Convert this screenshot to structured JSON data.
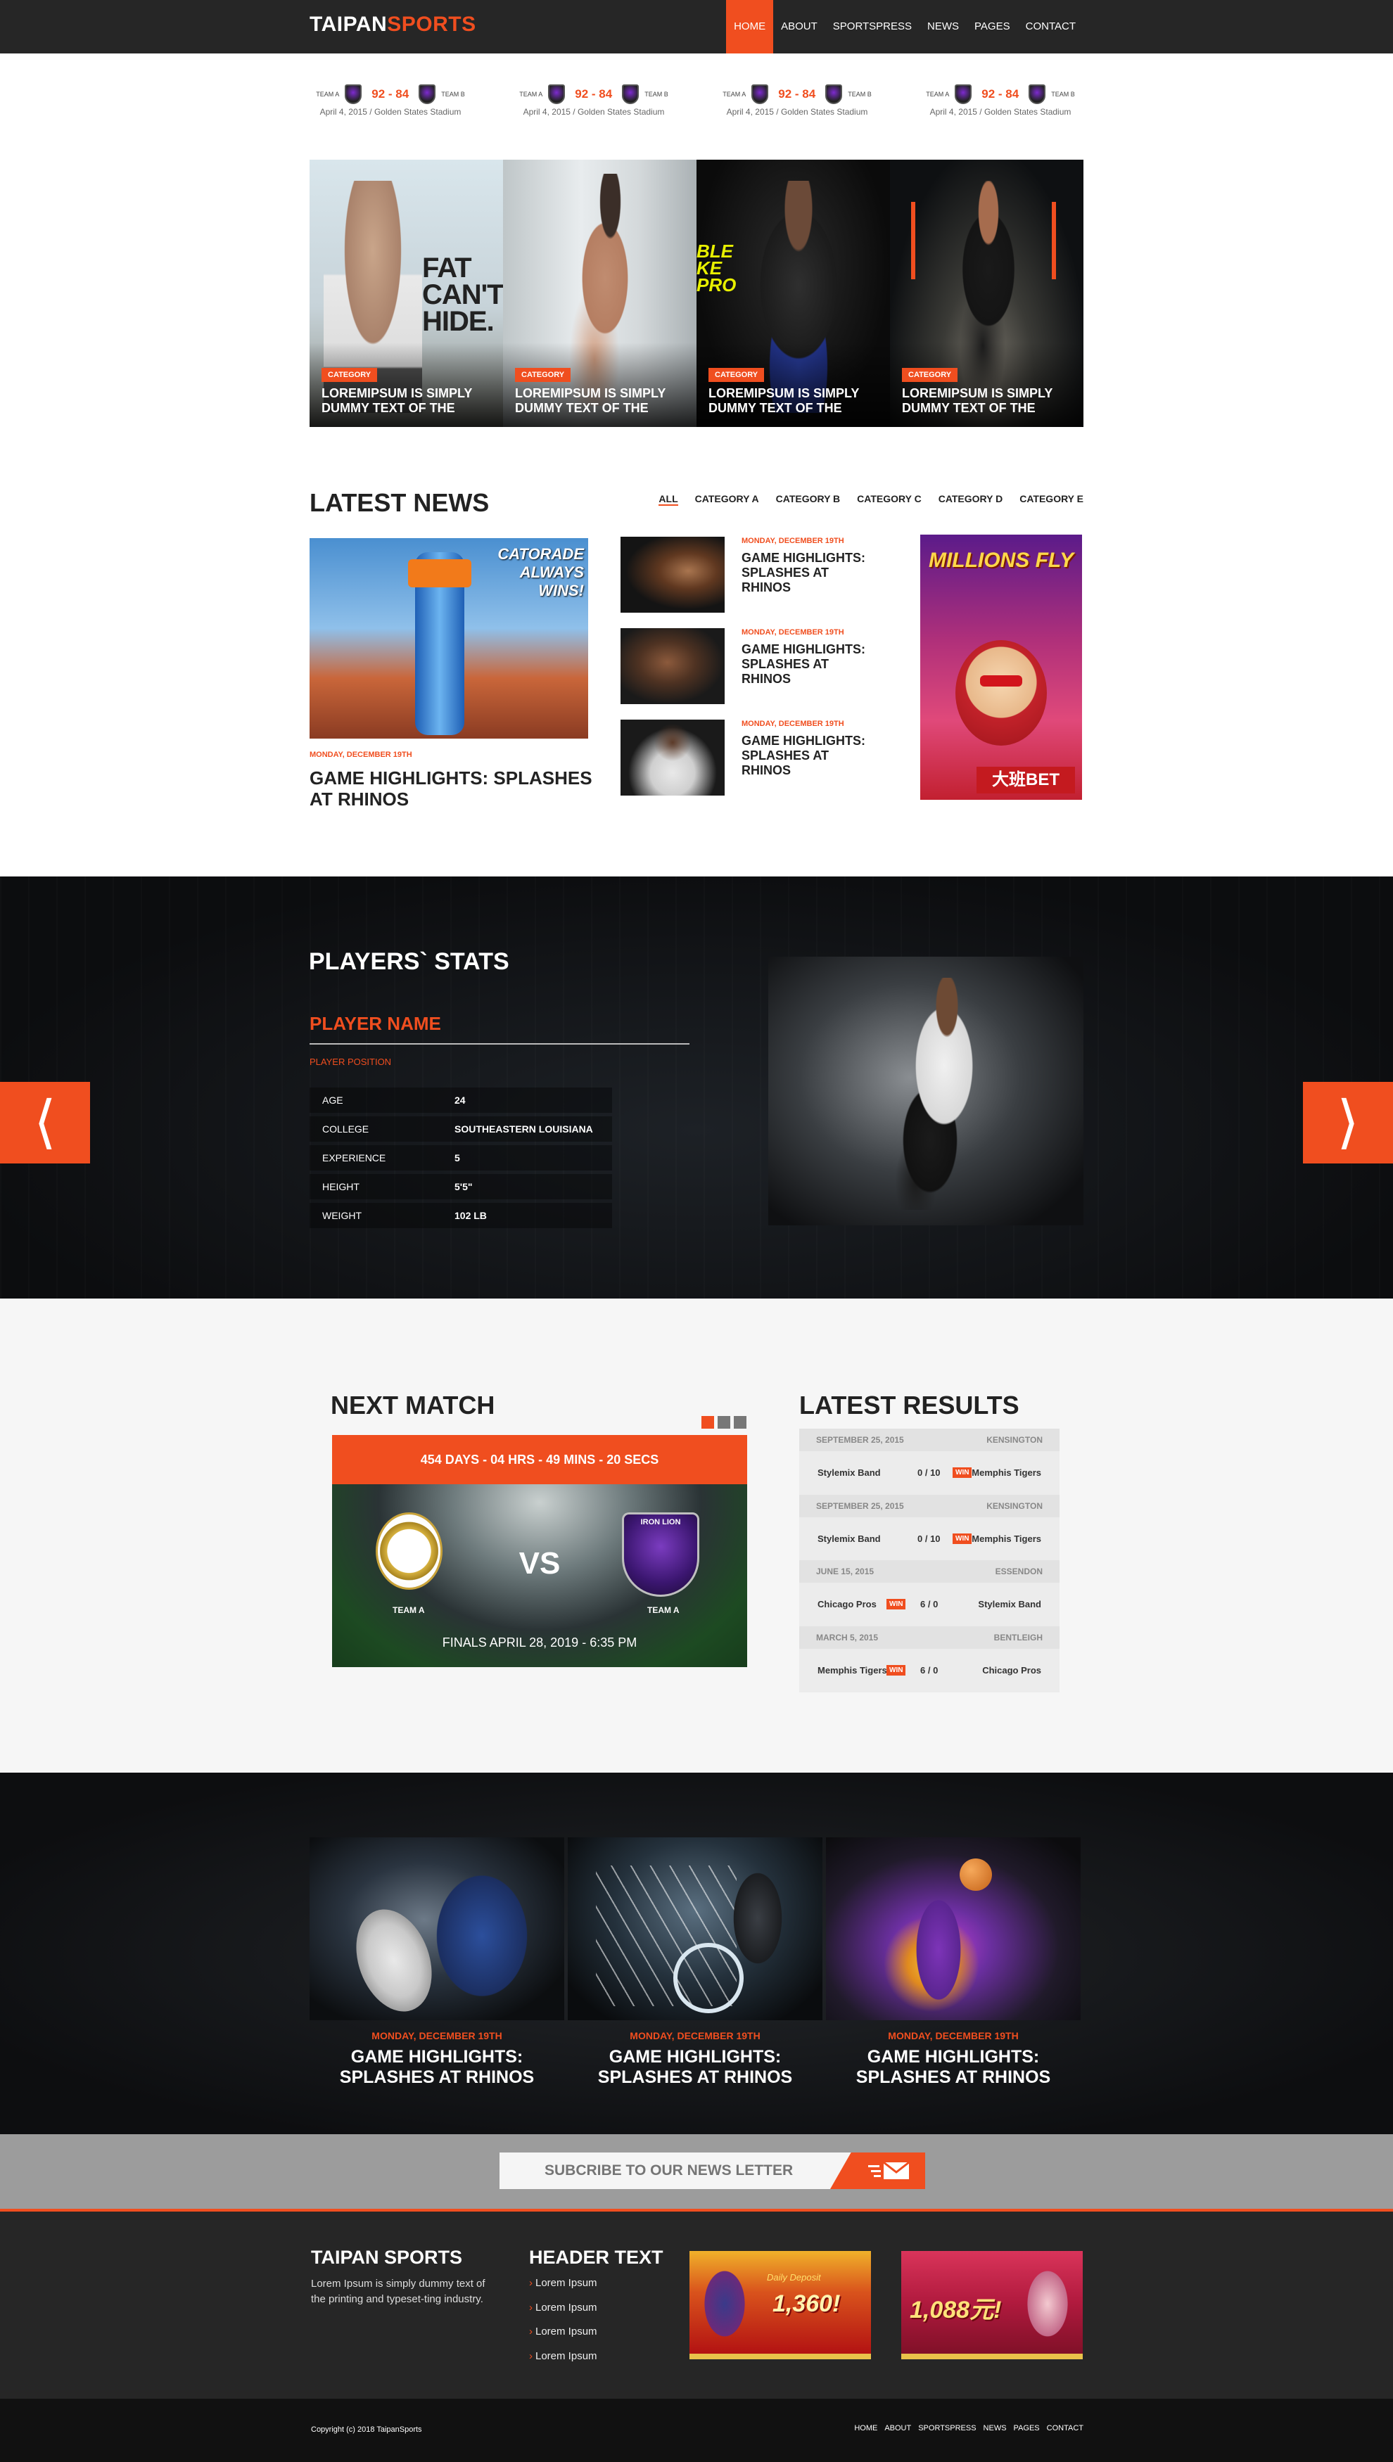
{
  "header": {
    "logo_a": "TAIPAN",
    "logo_b": "SPORTS",
    "nav": [
      "HOME",
      "ABOUT",
      "SPORTSPRESS",
      "NEWS",
      "PAGES",
      "CONTACT"
    ]
  },
  "scores": [
    {
      "home": "TEAM A",
      "away": "TEAM B",
      "score": "92 - 84",
      "date": "April 4, 2015 / Golden States Stadium"
    },
    {
      "home": "TEAM A",
      "away": "TEAM B",
      "score": "92 - 84",
      "date": "April 4, 2015 / Golden States Stadium"
    },
    {
      "home": "TEAM A",
      "away": "TEAM B",
      "score": "92 - 84",
      "date": "April 4, 2015 / Golden States Stadium"
    },
    {
      "home": "TEAM A",
      "away": "TEAM B",
      "score": "92 - 84",
      "date": "April 4, 2015 / Golden States Stadium"
    }
  ],
  "features": [
    {
      "category": "CATEGORY",
      "title": "LOREMIPSUM  IS SIMPLY DUMMY TEXT OF THE",
      "overlay": "FAT CAN'T HIDE."
    },
    {
      "category": "CATEGORY",
      "title": "LOREMIPSUM  IS SIMPLY DUMMY TEXT OF THE"
    },
    {
      "category": "CATEGORY",
      "title": "LOREMIPSUM  IS SIMPLY DUMMY TEXT OF THE",
      "overlay": "BLE KE PRO"
    },
    {
      "category": "CATEGORY",
      "title": "LOREMIPSUM  IS SIMPLY DUMMY TEXT OF THE"
    }
  ],
  "latest_news": {
    "title": "LATEST NEWS",
    "tabs": [
      "ALL",
      "CATEGORY A",
      "CATEGORY B",
      "CATEGORY C",
      "CATEGORY D",
      "CATEGORY E"
    ],
    "main": {
      "date": "MONDAY, DECEMBER 19TH",
      "title": "GAME HIGHLIGHTS: SPLASHES AT RHINOS",
      "img_text": "CATORADE ALWAYS WINS!"
    },
    "items": [
      {
        "date": "MONDAY, DECEMBER 19TH",
        "title": "GAME HIGHLIGHTS: SPLASHES AT RHINOS"
      },
      {
        "date": "MONDAY, DECEMBER 19TH",
        "title": "GAME HIGHLIGHTS: SPLASHES AT RHINOS"
      },
      {
        "date": "MONDAY, DECEMBER 19TH",
        "title": "GAME HIGHLIGHTS: SPLASHES AT RHINOS"
      }
    ],
    "ad": {
      "top": "MILLIONS FLY",
      "brand": "大班BET"
    }
  },
  "players": {
    "title": "PLAYERS` STATS",
    "name": "PLAYER NAME",
    "position": "PLAYER POSITION",
    "stats": [
      {
        "k": "AGE",
        "v": "24"
      },
      {
        "k": "COLLEGE",
        "v": "SOUTHEASTERN LOUISIANA"
      },
      {
        "k": "EXPERIENCE",
        "v": "5"
      },
      {
        "k": "HEIGHT",
        "v": "5'5\""
      },
      {
        "k": "WEIGHT",
        "v": "102 LB"
      }
    ],
    "prev": "⟨",
    "next": "⟩"
  },
  "next_match": {
    "title": "NEXT MATCH",
    "countdown": "454 DAYS - 04 HRS - 49 MINS - 20 SECS",
    "vs": "VS",
    "team_left": "TEAM A",
    "team_right": "TEAM A",
    "final": "FINALS APRIL 28, 2019 - 6:35 PM",
    "badge": "IRON LION"
  },
  "results": {
    "title": "LATEST RESULTS",
    "win": "WIN",
    "rows": [
      {
        "date": "SEPTEMBER 25, 2015",
        "venue": "KENSINGTON",
        "left": "Stylemix Band",
        "score": "0 / 10",
        "right": "Memphis Tigers",
        "win_side": "right"
      },
      {
        "date": "SEPTEMBER 25, 2015",
        "venue": "KENSINGTON",
        "left": "Stylemix Band",
        "score": "0 / 10",
        "right": "Memphis Tigers",
        "win_side": "right"
      },
      {
        "date": "JUNE 15, 2015",
        "venue": "ESSENDON",
        "left": "Chicago Pros",
        "score": "6 / 0",
        "right": "Stylemix Band",
        "win_side": "left"
      },
      {
        "date": "MARCH 5, 2015",
        "venue": "BENTLEIGH",
        "left": "Memphis Tigers",
        "score": "6 / 0",
        "right": "Chicago Pros",
        "win_side": "left"
      }
    ]
  },
  "gallery": [
    {
      "date": "MONDAY, DECEMBER 19TH",
      "title": "GAME HIGHLIGHTS: SPLASHES AT RHINOS"
    },
    {
      "date": "MONDAY, DECEMBER 19TH",
      "title": "GAME HIGHLIGHTS: SPLASHES AT RHINOS"
    },
    {
      "date": "MONDAY, DECEMBER 19TH",
      "title": "GAME HIGHLIGHTS: SPLASHES AT RHINOS"
    }
  ],
  "newsletter": {
    "placeholder": "SUBCRIBE TO OUR NEWS LETTER"
  },
  "footer": {
    "brand": "TAIPAN SPORTS",
    "about": "Lorem Ipsum is simply dummy text of the printing and typeset-ting industry.",
    "links_title": "HEADER TEXT",
    "links": [
      "Lorem Ipsum",
      "Lorem Ipsum",
      "Lorem Ipsum",
      "Lorem Ipsum"
    ],
    "ad1": "1,360!",
    "ad1_small": "Daily Deposit",
    "ad2": "1,088元!",
    "copyright": "Copyright (c) 2018 TaipanSports",
    "nav": [
      "HOME",
      "ABOUT",
      "SPORTSPRESS",
      "NEWS",
      "PAGES",
      "CONTACT"
    ]
  },
  "colors": {
    "accent": "#f04e1f",
    "dark": "#262626"
  }
}
